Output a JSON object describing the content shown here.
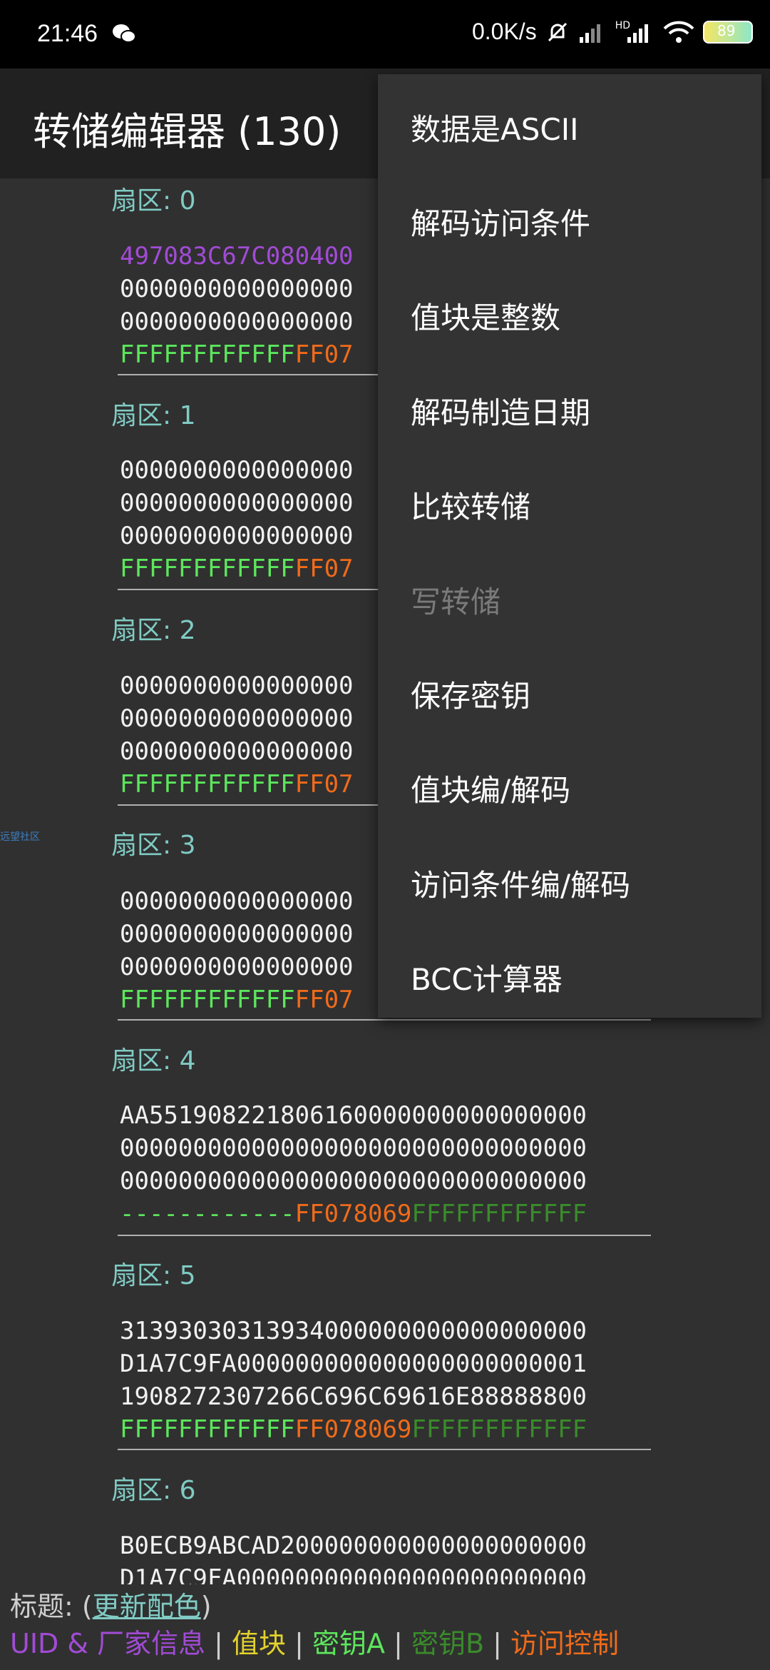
{
  "status_bar": {
    "time": "21:46",
    "speed": "0.0K/s",
    "network": "HD",
    "battery": "89"
  },
  "app_bar": {
    "title": "转储编辑器 (130)"
  },
  "sectors": [
    {
      "label": "扇区: 0",
      "lines": [
        "497083C67C080400",
        "0000000000000000",
        "0000000000000000"
      ],
      "trailer_key": "FFFFFFFFFFFF",
      "trailer_access": "FF07"
    },
    {
      "label": "扇区: 1",
      "lines": [
        "0000000000000000",
        "0000000000000000",
        "0000000000000000"
      ],
      "trailer_key": "FFFFFFFFFFFF",
      "trailer_access": "FF07"
    },
    {
      "label": "扇区: 2",
      "lines": [
        "0000000000000000",
        "0000000000000000",
        "0000000000000000"
      ],
      "trailer_key": "FFFFFFFFFFFF",
      "trailer_access": "FF07"
    },
    {
      "label": "扇区: 3",
      "lines": [
        "0000000000000000",
        "0000000000000000",
        "0000000000000000"
      ],
      "trailer_key": "FFFFFFFFFFFF",
      "trailer_access": "FF07"
    },
    {
      "label": "扇区: 4",
      "lines": [
        "AA551908221806160000000000000000",
        "00000000000000000000000000000000",
        "00000000000000000000000000000000"
      ],
      "trailer_key": "------------",
      "trailer_access": "FF078069",
      "trailer_keyb": "FFFFFFFFFFFF"
    },
    {
      "label": "扇区: 5",
      "lines": [
        "31393030313934000000000000000000",
        "D1A7C9FA000000000000000000000001",
        "1908272307266C696C69616E88888800"
      ],
      "trailer_key": "FFFFFFFFFFFF",
      "trailer_access": "FF078069",
      "trailer_keyb": "FFFFFFFFFFFF"
    },
    {
      "label": "扇区: 6",
      "lines": [
        "B0ECB9ABCAD200000000000000000000",
        "D1A7C9FA000000000000000000000000"
      ]
    }
  ],
  "side_watermark": "远望社区",
  "legend": {
    "prefix": "标题: (",
    "link": "更新配色",
    "suffix": ")",
    "uid": "UID & 厂家信息",
    "sep": " | ",
    "value": "值块",
    "keya": "密钥A",
    "keyb": "密钥B",
    "access": "访问控制"
  },
  "menu": {
    "items": [
      {
        "label": "数据是ASCII",
        "enabled": true
      },
      {
        "label": "解码访问条件",
        "enabled": true
      },
      {
        "label": "值块是整数",
        "enabled": true
      },
      {
        "label": "解码制造日期",
        "enabled": true
      },
      {
        "label": "比较转储",
        "enabled": true
      },
      {
        "label": "写转储",
        "enabled": false
      },
      {
        "label": "保存密钥",
        "enabled": true
      },
      {
        "label": "值块编/解码",
        "enabled": true
      },
      {
        "label": "访问条件编/解码",
        "enabled": true
      },
      {
        "label": "BCC计算器",
        "enabled": true
      }
    ]
  },
  "colors": {
    "uid": "#a24bd6",
    "value": "#e2d12c",
    "keya": "#5ce65c",
    "keyb": "#3a8b2b",
    "access": "#f06b1a",
    "sector_title": "#80cbc4"
  }
}
